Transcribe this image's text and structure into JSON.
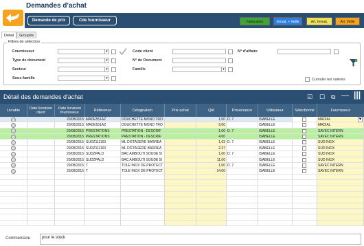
{
  "header": {
    "title": "Demandes d'achat",
    "buttons": [
      "Demande de prix",
      "Cde fournisseur"
    ],
    "tags": [
      {
        "label": "Fabrication",
        "color": "#3fa535",
        "text": "#1a1a1a"
      },
      {
        "label": "Immat. + Veille",
        "color": "#2f7fe0",
        "text": "#ffffff"
      },
      {
        "label": "Art. Immat.",
        "color": "#f0e05a",
        "text": "#1a1a1a"
      },
      {
        "label": "Art. Veille",
        "color": "#f5a21e",
        "text": "#1a1a1a"
      }
    ]
  },
  "tabs": [
    "Détail",
    "Groupés"
  ],
  "filters": {
    "legend": "Filtres de sélection",
    "fournisseur": "Fournisseur",
    "type_document": "Type de document",
    "secteur": "Secteur",
    "sous_famille": "Sous-famille",
    "code_client": "Code client",
    "no_document": "N° de Document",
    "famille": "Famille",
    "no_affaire": "N° d'affaire",
    "cumuler": "Cumuler les valeurs"
  },
  "detail": {
    "title": "Détail des demandes d'achat"
  },
  "table": {
    "columns": [
      "Livrable",
      "Date livraison client",
      "Date livraison fournisseur",
      "Référence",
      "Désignation",
      "Prix achat",
      "Qté",
      "Provenance",
      "Utilisateur",
      "Sélectionné",
      "Fournisseur"
    ],
    "rows": [
      {
        "date": "20/08/2015",
        "ref": "MADE551AZ",
        "designation": "DOUCHETTE MONO TRO",
        "qte": "1,00",
        "prov": "D. 7",
        "user": "ISABELLE",
        "fourn": "MADIAL",
        "bg": "#ffffff",
        "first": true
      },
      {
        "date": "20/08/2015",
        "ref": "MADE551AZ",
        "designation": "DOUCHETTE MONO TRO",
        "qte": "9,00",
        "prov": "",
        "user": "ISABELLE",
        "fourn": "MADIAL",
        "bg": "#ffffff"
      },
      {
        "date": "20/08/2015",
        "ref": "PRESTATIONS",
        "designation": "PRESTATION - DESCRIF",
        "qte": "1,00",
        "prov": "D. 7",
        "user": "ISABELLE",
        "fourn": "SAVEC INTERN",
        "bg": "#b9f0a0"
      },
      {
        "date": "20/08/2015",
        "ref": "PRESTATIONS",
        "designation": "PRESTATION - DESCRIF",
        "qte": "4,00",
        "prov": "",
        "user": "ISABELLE",
        "fourn": "SAVEC INTERN",
        "bg": "#b9f0a0"
      },
      {
        "date": "20/08/2015",
        "ref": "SUDZ111163",
        "designation": "ML D'ETAGERE BARREA",
        "qte": "1,63",
        "prov": "D. 7",
        "user": "ISABELLE",
        "fourn": "SUD INOX",
        "bg": "#ffffff"
      },
      {
        "date": "20/08/2015",
        "ref": "SUDZ111163",
        "designation": "ML D'ETAGERE BARREA",
        "qte": "2,37",
        "prov": "",
        "user": "ISABELLE",
        "fourn": "SUD INOX",
        "bg": "#ffffff"
      },
      {
        "date": "20/08/2015",
        "ref": "SUDZPALD",
        "designation": "BAC AMBOUTI SOUDE 5I",
        "qte": "1,00",
        "prov": "D. 7",
        "user": "ISABELLE",
        "fourn": "SUD INOX",
        "bg": "#ffffff"
      },
      {
        "date": "20/08/2015",
        "ref": "SUDZPALD",
        "designation": "BAC AMBOUTI SOUDE 5I",
        "qte": "11,00",
        "prov": "",
        "user": "ISABELLE",
        "fourn": "SUD INOX",
        "bg": "#ffffff"
      },
      {
        "date": "20/08/2015",
        "ref": "T",
        "designation": "TOLE INOX DE PROTECT",
        "qte": "1,00",
        "prov": "D. 7",
        "user": "ISABELLE",
        "fourn": "SAVEC INTERN",
        "bg": "#ffffff"
      },
      {
        "date": "20/08/2015",
        "ref": "T",
        "designation": "TOLE INOX DE PROTECT",
        "qte": "14,00",
        "prov": "",
        "user": "ISABELLE",
        "fourn": "SAVEC INTERN",
        "bg": "#ffffff"
      }
    ]
  },
  "comment": {
    "label": "Commentaire",
    "value": "pour le stock"
  }
}
